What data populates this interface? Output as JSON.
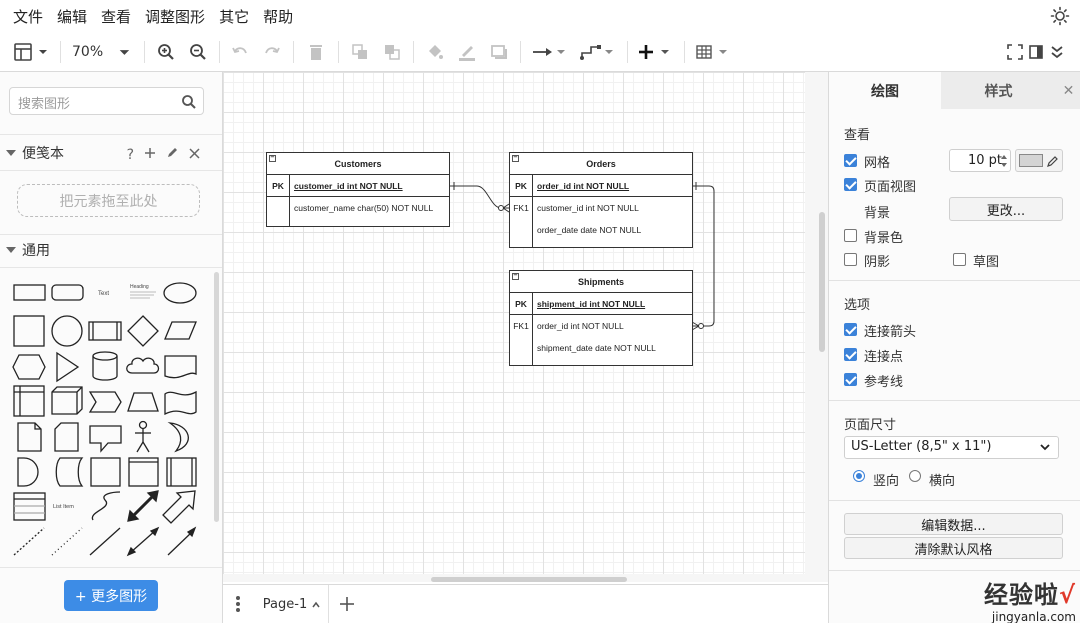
{
  "menu": [
    "文件",
    "编辑",
    "查看",
    "调整图形",
    "其它",
    "帮助"
  ],
  "toolbar": {
    "zoom": "70%"
  },
  "left": {
    "search_placeholder": "搜索图形",
    "scratchpad_title": "便笺本",
    "scratchpad_tools": "?",
    "dropzone": "把元素拖至此处",
    "general_title": "通用",
    "more_shapes": "+ 更多图形",
    "shape_labels": {
      "text": "Text",
      "heading": "Heading",
      "list_item": "List Item"
    }
  },
  "diagram": {
    "customers": {
      "title": "Customers",
      "rows": [
        {
          "key": "PK",
          "field": "customer_id int NOT NULL"
        },
        {
          "key": "",
          "field": "customer_name char(50) NOT NULL"
        }
      ]
    },
    "orders": {
      "title": "Orders",
      "rows": [
        {
          "key": "PK",
          "field": "order_id int NOT NULL"
        },
        {
          "key": "FK1",
          "field": "customer_id int NOT NULL"
        },
        {
          "key": "",
          "field": "order_date date NOT NULL"
        }
      ]
    },
    "shipments": {
      "title": "Shipments",
      "rows": [
        {
          "key": "PK",
          "field": "shipment_id int NOT NULL"
        },
        {
          "key": "FK1",
          "field": "order_id int NOT NULL"
        },
        {
          "key": "",
          "field": "shipment_date date NOT NULL"
        }
      ]
    }
  },
  "pages": {
    "tab": "Page-1"
  },
  "right": {
    "tab_diagram": "绘图",
    "tab_style": "样式",
    "close": "✕",
    "view_title": "查看",
    "grid": "网格",
    "grid_size": "10 pt",
    "page_view": "页面视图",
    "background": "背景",
    "change": "更改...",
    "background_color": "背景色",
    "shadow": "阴影",
    "sketch": "草图",
    "options_title": "选项",
    "connection_arrows": "连接箭头",
    "connection_points": "连接点",
    "guides": "参考线",
    "page_size_title": "页面尺寸",
    "page_size": "US-Letter (8,5\" x 11\")",
    "portrait": "竖向",
    "landscape": "横向",
    "edit_data": "编辑数据...",
    "clear_style": "清除默认风格",
    "checkbox_states": {
      "grid": true,
      "page_view": true,
      "background_color": false,
      "shadow": false,
      "sketch": false,
      "connection_arrows": true,
      "connection_points": true,
      "guides": true
    },
    "orientation": "portrait"
  },
  "watermark": {
    "line1": "经验啦",
    "check": "√",
    "line2": "jingyanla.com"
  },
  "colors": {
    "accent": "#3b82d9",
    "button_blue": "#3d8ce6"
  }
}
